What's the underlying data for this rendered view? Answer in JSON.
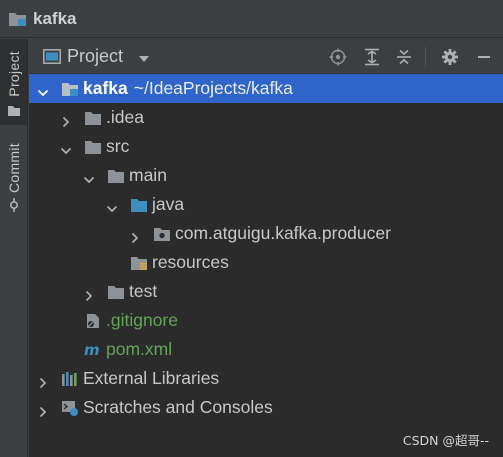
{
  "window": {
    "title": "kafka",
    "title_icon": "project-folder-icon"
  },
  "side_tabs": [
    {
      "label": "Project",
      "icon": "folder-icon",
      "active": true
    },
    {
      "label": "Commit",
      "icon": "commit-icon",
      "active": false
    }
  ],
  "tool_window": {
    "title": "Project",
    "buttons": [
      "locate-icon",
      "expand-all-icon",
      "collapse-all-icon",
      "gear-icon",
      "hide-icon"
    ]
  },
  "tree": [
    {
      "label": "kafka",
      "extra": "~/IdeaProjects/kafka",
      "level": 0,
      "arrow": "down",
      "icon": "module-folder-icon",
      "selected": true
    },
    {
      "label": ".idea",
      "level": 1,
      "arrow": "right",
      "icon": "folder-icon"
    },
    {
      "label": "src",
      "level": 1,
      "arrow": "down",
      "icon": "folder-icon"
    },
    {
      "label": "main",
      "level": 2,
      "arrow": "down",
      "icon": "folder-icon"
    },
    {
      "label": "java",
      "level": 3,
      "arrow": "down",
      "icon": "source-folder-icon"
    },
    {
      "label": "com.atguigu.kafka.producer",
      "level": 4,
      "arrow": "right",
      "icon": "package-icon"
    },
    {
      "label": "resources",
      "level": 3,
      "arrow": "none",
      "icon": "resources-folder-icon"
    },
    {
      "label": "test",
      "level": 2,
      "arrow": "right",
      "icon": "folder-icon"
    },
    {
      "label": ".gitignore",
      "level": 1,
      "arrow": "none",
      "icon": "gitignore-file-icon",
      "color": "#62a557"
    },
    {
      "label": "pom.xml",
      "level": 1,
      "arrow": "none",
      "icon": "maven-icon",
      "color": "#62a557"
    },
    {
      "label": "External Libraries",
      "level": 0,
      "arrow": "right",
      "icon": "libraries-icon"
    },
    {
      "label": "Scratches and Consoles",
      "level": 0,
      "arrow": "right",
      "icon": "scratches-icon"
    }
  ],
  "watermark": "CSDN @超哥--",
  "colors": {
    "selection": "#2f65ca",
    "tree_bg": "#2b2b2b",
    "panel_bg": "#3c3f41",
    "vcs_added": "#62a557",
    "folder": "#8d9399",
    "source_folder": "#3d8fc0"
  }
}
